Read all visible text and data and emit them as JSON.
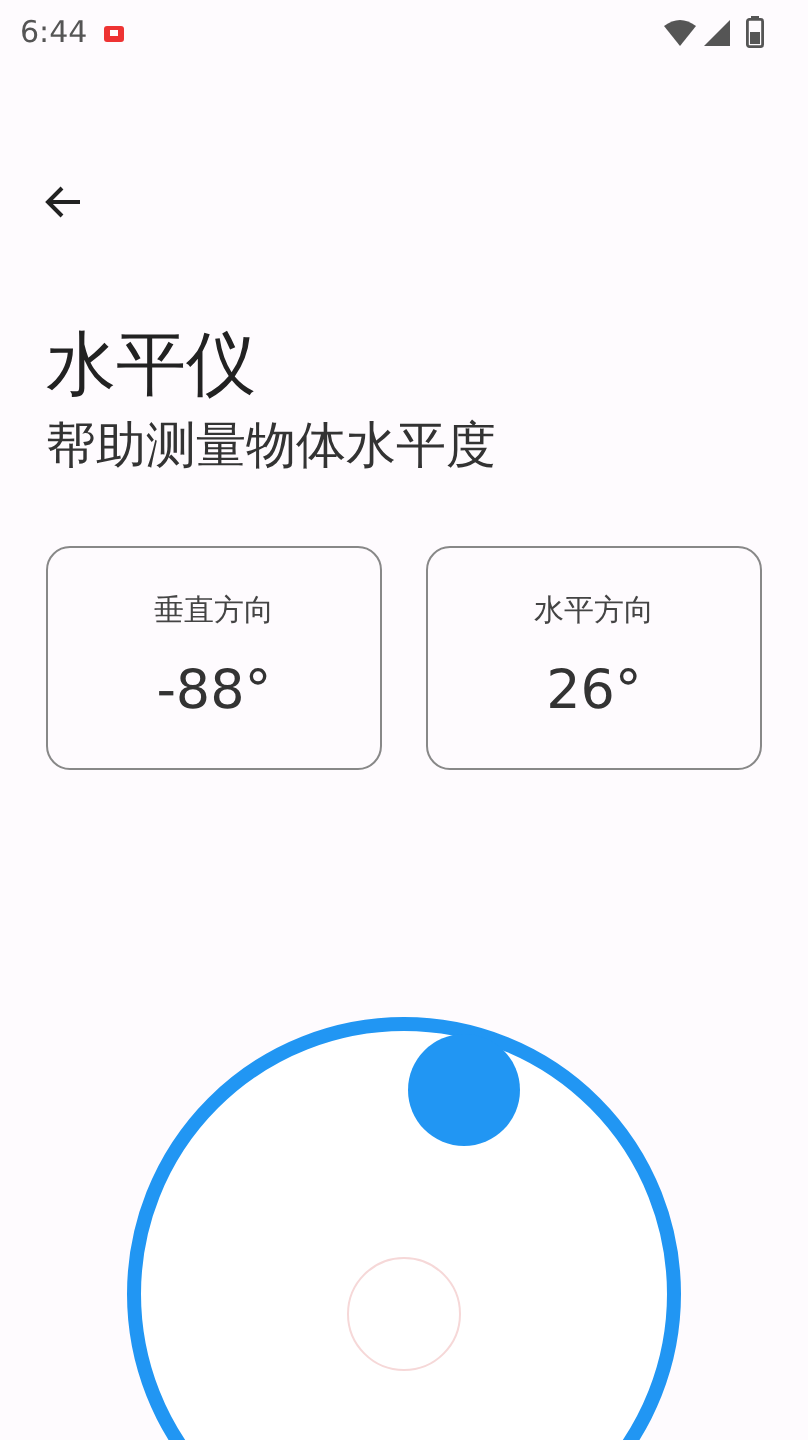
{
  "status_bar": {
    "time": "6:44"
  },
  "title": "水平仪",
  "subtitle": "帮助测量物体水平度",
  "readings": [
    {
      "label": "垂直方向",
      "value": "-88°"
    },
    {
      "label": "水平方向",
      "value": "26°"
    }
  ]
}
